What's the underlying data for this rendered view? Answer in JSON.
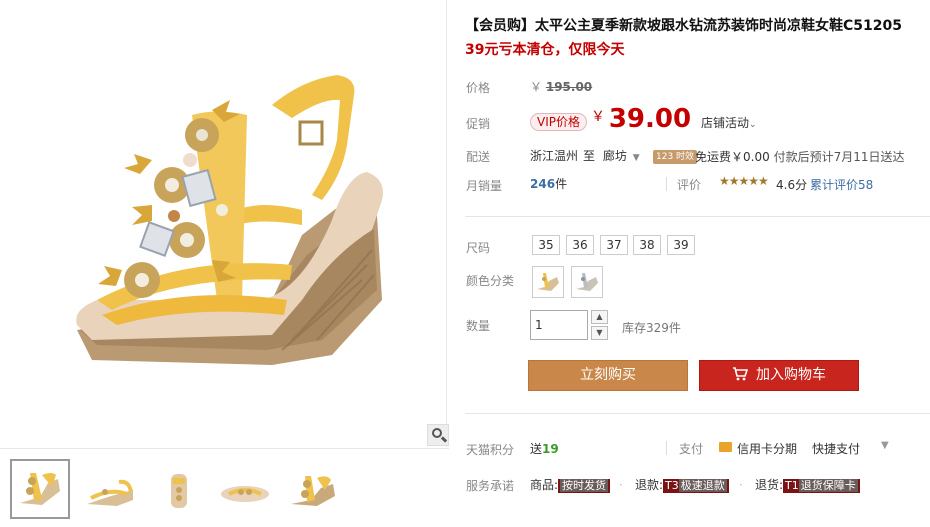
{
  "product": {
    "title": "【会员购】太平公主夏季新款坡跟水钻流苏装饰时尚凉鞋女鞋C51205",
    "promo": "39元亏本清仓，仅限今天"
  },
  "price_row": {
    "label": "价格",
    "currency": "￥",
    "original": "195.00"
  },
  "promo_row": {
    "label": "促销",
    "vip_label": "VIP价格",
    "currency": "￥",
    "price": "39.00",
    "shop_activity": "店铺活动"
  },
  "delivery": {
    "label": "配送",
    "from": "浙江温州",
    "to_word": "至",
    "destination": "廊坊",
    "tag": "123 时效",
    "shipping": "免运费￥0.00",
    "note": "付款后预计7月11日送达"
  },
  "sales": {
    "label": "月销量",
    "count": "246",
    "unit": "件",
    "rating_label": "评价",
    "stars": "★★★★★",
    "score": "4.6分",
    "rating_count": "累计评价58"
  },
  "size": {
    "label": "尺码",
    "options": [
      "35",
      "36",
      "37",
      "38",
      "39"
    ]
  },
  "color": {
    "label": "颜色分类"
  },
  "quantity": {
    "label": "数量",
    "value": "1",
    "stock": "库存329件"
  },
  "actions": {
    "buy_now": "立刻购买",
    "add_cart": "加入购物车"
  },
  "points": {
    "label": "天猫积分",
    "prefix": "送",
    "value": "19",
    "pay_label": "支付",
    "card_pay": "信用卡分期",
    "quick_pay": "快捷支付"
  },
  "service": {
    "label": "服务承诺",
    "goods": "商品:",
    "goods_tag": "按时发货",
    "refund": "退款:",
    "refund_code": "T3",
    "refund_tag": "极速退款",
    "return": "退货:",
    "return_code": "T1",
    "return_tag": "退货保障卡"
  },
  "colors": {
    "accent_red": "#c40000",
    "buy_button": "#c9874a",
    "cart_button": "#c8251e",
    "link_blue": "#3c6ea6"
  },
  "icons": [
    "zoom-icon",
    "cart-icon",
    "credit-card-icon",
    "chevron-down-icon",
    "star-icon"
  ]
}
